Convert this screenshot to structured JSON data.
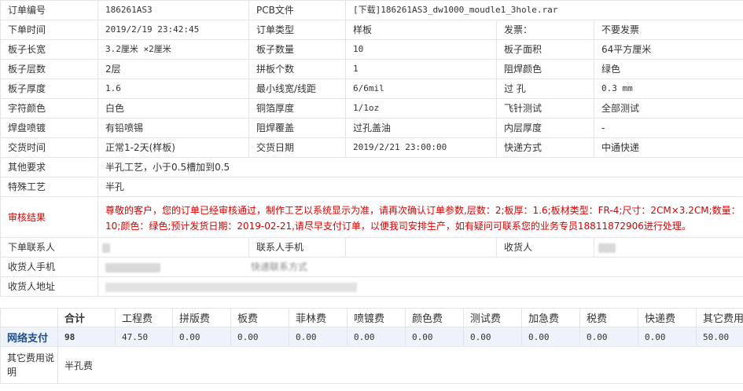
{
  "order": {
    "rows": [
      [
        {
          "t": "订单编号",
          "l": 1
        },
        {
          "t": "186261AS3",
          "m": 1
        },
        {
          "t": "PCB文件",
          "l": 1
        },
        {
          "t": "[下载]186261AS3_dw1000_moudle1_3hole.rar",
          "m": 1,
          "span": 3
        }
      ],
      [
        {
          "t": "下单时间",
          "l": 1
        },
        {
          "t": "2019/2/19 23:42:45",
          "m": 1
        },
        {
          "t": "订单类型",
          "l": 1
        },
        {
          "t": "样板"
        },
        {
          "t": "发票：",
          "l": 1
        },
        {
          "t": "不要发票"
        }
      ],
      [
        {
          "t": "板子长宽",
          "l": 1
        },
        {
          "t": "3.2厘米 ×2厘米",
          "m": 1
        },
        {
          "t": "板子数量",
          "l": 1
        },
        {
          "t": "10",
          "m": 1
        },
        {
          "t": "板子面积",
          "l": 1
        },
        {
          "t": "64平方厘米"
        }
      ],
      [
        {
          "t": "板子层数",
          "l": 1
        },
        {
          "t": "2层"
        },
        {
          "t": "拼板个数",
          "l": 1
        },
        {
          "t": "1",
          "m": 1
        },
        {
          "t": "阻焊颜色",
          "l": 1
        },
        {
          "t": "绿色"
        }
      ],
      [
        {
          "t": "板子厚度",
          "l": 1
        },
        {
          "t": "1.6",
          "m": 1
        },
        {
          "t": "最小线宽/线距",
          "l": 1
        },
        {
          "t": "6/6mil",
          "m": 1
        },
        {
          "t": "过 孔",
          "l": 1
        },
        {
          "t": "0.3 mm",
          "m": 1
        }
      ],
      [
        {
          "t": "字符颜色",
          "l": 1
        },
        {
          "t": "白色"
        },
        {
          "t": "铜箔厚度",
          "l": 1
        },
        {
          "t": "1/1oz",
          "m": 1
        },
        {
          "t": "飞针测试",
          "l": 1
        },
        {
          "t": "全部测试"
        }
      ],
      [
        {
          "t": "焊盘喷镀",
          "l": 1
        },
        {
          "t": "有铅喷锡"
        },
        {
          "t": "阻焊覆盖",
          "l": 1
        },
        {
          "t": "过孔盖油"
        },
        {
          "t": "内层厚度",
          "l": 1
        },
        {
          "t": "-"
        }
      ],
      [
        {
          "t": "交货时间",
          "l": 1
        },
        {
          "t": "正常1-2天(样板)"
        },
        {
          "t": "交货日期",
          "l": 1
        },
        {
          "t": "2019/2/21 23:00:00",
          "m": 1
        },
        {
          "t": "快递方式",
          "l": 1
        },
        {
          "t": "中通快递"
        }
      ],
      [
        {
          "t": "其他要求",
          "l": 1
        },
        {
          "t": "半孔工艺，小于0.5槽加到0.5",
          "span": 5
        }
      ],
      [
        {
          "t": "特殊工艺",
          "l": 1
        },
        {
          "t": "半孔",
          "span": 5
        }
      ]
    ],
    "review_label": "审核结果",
    "review_text": "尊敬的客户，您的订单已经审核通过，制作工艺以系统显示为准，请再次确认订单参数,层数：2;板厚：1.6;板材类型：FR-4;尺寸：2CM×3.2CM;数量：10;颜色：绿色;预计发货日期：2019-02-21,请尽早支付订单，以便我司安排生产，如有疑问可联系您的业务专员18811872906进行处理。",
    "contact_rows": [
      {
        "label": "下单联系人",
        "label2": "联系人手机",
        "label3": "收货人"
      },
      {
        "label": "收货人手机",
        "label2": "",
        "label3": ""
      },
      {
        "label": "收货人地址",
        "label2": "",
        "label3": ""
      }
    ],
    "contact_partial_text": "快递联系方式"
  },
  "fees": {
    "headers": [
      "合计",
      "工程费",
      "拼版费",
      "板费",
      "菲林费",
      "喷镀费",
      "颜色费",
      "测试费",
      "加急费",
      "税费",
      "快递费",
      "其它费用"
    ],
    "pay_label": "网络支付",
    "values": [
      "98",
      "47.50",
      "0.00",
      "0.00",
      "0.00",
      "0.00",
      "0.00",
      "0.00",
      "0.00",
      "0.00",
      "0.00",
      "50.00"
    ],
    "other_label": "其它费用说明",
    "other_text": "半孔费"
  },
  "colors": {
    "review_red": "#d60000",
    "pay_bg": "#eef3fb",
    "pay_label": "#1f4f8f",
    "border": "#e4e4e4"
  }
}
